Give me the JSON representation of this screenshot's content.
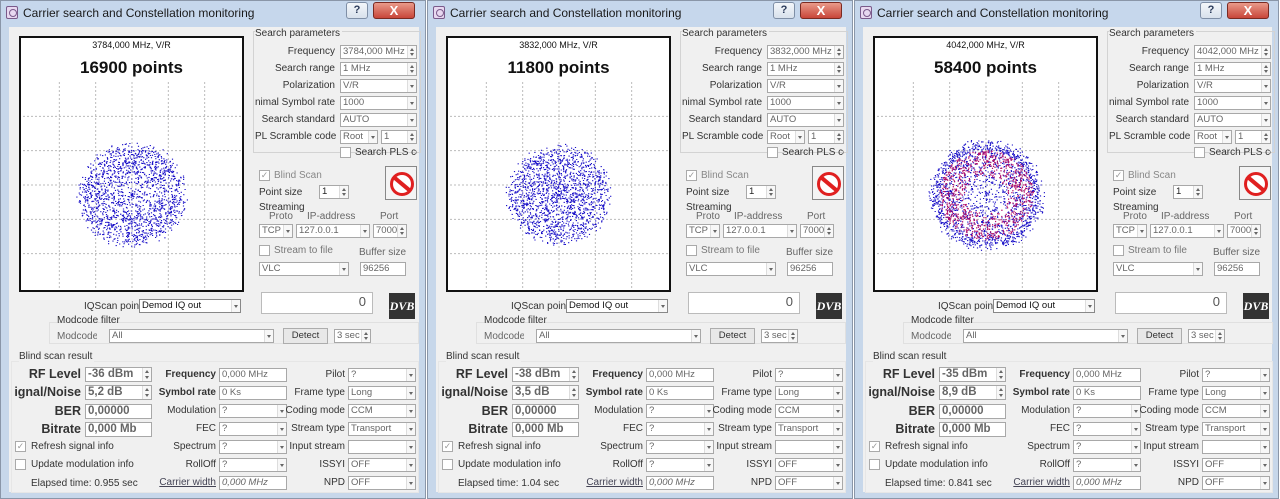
{
  "panels": [
    {
      "title": "Carrier search and Constellation monitoring",
      "help": "?",
      "close": "X",
      "plot": {
        "freq_label": "3784,000 MHz, V/R",
        "points": "16900 points",
        "inner": 0.12,
        "outer": 0.84,
        "dense": false
      },
      "search": {
        "header": "Search parameters",
        "frequency_label": "Frequency",
        "frequency": "3784,000 MHz",
        "range_label": "Search range",
        "range": "1 MHz",
        "pol_label": "Polarization",
        "pol": "V/R",
        "symrate_label": "nimal Symbol rate",
        "symrate": "1000",
        "standard_label": "Search standard",
        "standard": "AUTO",
        "pls_label": "PL Scramble code",
        "pls_mode": "Root",
        "pls_value": "1",
        "search_pls": "Search PLS cc"
      },
      "blind": {
        "label": "Blind Scan",
        "point_size_label": "Point size",
        "point_size": "1"
      },
      "streaming": {
        "header": "Streaming",
        "proto_label": "Proto",
        "ip_label": "IP-address",
        "port_label": "Port",
        "proto": "TCP",
        "ip": "127.0.0.1",
        "port": "7000",
        "to_file": "Stream to file",
        "buffer_label": "Buffer size",
        "player": "VLC",
        "buffer": "96256"
      },
      "indicator": "0",
      "dvb": "DVB",
      "iq": {
        "label": "IQScan point",
        "value": "Demod IQ out"
      },
      "modcode": {
        "header": "Modcode filter",
        "label": "Modcode",
        "value": "All",
        "detect": "Detect",
        "sec": "3 sec"
      },
      "result": {
        "header": "Blind scan result",
        "rf_label": "RF Level",
        "rf": "-36 dBm",
        "sn_label": "ignal/Noise",
        "sn": "5,2 dB",
        "ber_label": "BER",
        "ber": "0,00000",
        "bitrate_label": "Bitrate",
        "bitrate": "0,000 Mb",
        "freq_label": "Frequency",
        "freq": "0,000 MHz",
        "sym_label": "Symbol rate",
        "sym": "0 Ks",
        "modulation_label": "Modulation",
        "modulation": "?",
        "fec_label": "FEC",
        "fec": "?",
        "spectrum_label": "Spectrum",
        "spectrum": "?",
        "rolloff_label": "RollOff",
        "rolloff": "?",
        "cw_label": "Carrier width",
        "cw": "0,000 MHz",
        "pilot_label": "Pilot",
        "pilot": "?",
        "frame_label": "Frame type",
        "frame": "Long",
        "coding_label": "Coding mode",
        "coding": "CCM",
        "stype_label": "Stream type",
        "stype": "Transport",
        "istream_label": "Input stream",
        "istream": "",
        "issyi_label": "ISSYI",
        "issyi": "OFF",
        "npd_label": "NPD",
        "npd": "OFF",
        "refresh": "Refresh signal info",
        "update": "Update modulation info",
        "elapsed": "Elapsed time: 0.955 sec"
      }
    },
    {
      "title": "Carrier search and Constellation monitoring",
      "help": "?",
      "close": "X",
      "plot": {
        "freq_label": "3832,000 MHz, V/R",
        "points": "11800 points",
        "inner": 0.0,
        "outer": 0.8,
        "dense": false
      },
      "search": {
        "header": "Search parameters",
        "frequency_label": "Frequency",
        "frequency": "3832,000 MHz",
        "range_label": "Search range",
        "range": "1 MHz",
        "pol_label": "Polarization",
        "pol": "V/R",
        "symrate_label": "nimal Symbol rate",
        "symrate": "1000",
        "standard_label": "Search standard",
        "standard": "AUTO",
        "pls_label": "PL Scramble code",
        "pls_mode": "Root",
        "pls_value": "1",
        "search_pls": "Search PLS cc"
      },
      "blind": {
        "label": "Blind Scan",
        "point_size_label": "Point size",
        "point_size": "1"
      },
      "streaming": {
        "header": "Streaming",
        "proto_label": "Proto",
        "ip_label": "IP-address",
        "port_label": "Port",
        "proto": "TCP",
        "ip": "127.0.0.1",
        "port": "7000",
        "to_file": "Stream to file",
        "buffer_label": "Buffer size",
        "player": "VLC",
        "buffer": "96256"
      },
      "indicator": "0",
      "dvb": "DVB",
      "iq": {
        "label": "IQScan point",
        "value": "Demod IQ out"
      },
      "modcode": {
        "header": "Modcode filter",
        "label": "Modcode",
        "value": "All",
        "detect": "Detect",
        "sec": "3 sec"
      },
      "result": {
        "header": "Blind scan result",
        "rf_label": "RF Level",
        "rf": "-38 dBm",
        "sn_label": "ignal/Noise",
        "sn": "3,5 dB",
        "ber_label": "BER",
        "ber": "0,00000",
        "bitrate_label": "Bitrate",
        "bitrate": "0,000 Mb",
        "freq_label": "Frequency",
        "freq": "0,000 MHz",
        "sym_label": "Symbol rate",
        "sym": "0 Ks",
        "modulation_label": "Modulation",
        "modulation": "?",
        "fec_label": "FEC",
        "fec": "?",
        "spectrum_label": "Spectrum",
        "spectrum": "?",
        "rolloff_label": "RollOff",
        "rolloff": "?",
        "cw_label": "Carrier width",
        "cw": "0,000 MHz",
        "pilot_label": "Pilot",
        "pilot": "?",
        "frame_label": "Frame type",
        "frame": "Long",
        "coding_label": "Coding mode",
        "coding": "CCM",
        "stype_label": "Stream type",
        "stype": "Transport",
        "istream_label": "Input stream",
        "istream": "",
        "issyi_label": "ISSYI",
        "issyi": "OFF",
        "npd_label": "NPD",
        "npd": "OFF",
        "refresh": "Refresh signal info",
        "update": "Update modulation info",
        "elapsed": "Elapsed time: 1.04 sec"
      }
    },
    {
      "title": "Carrier search and Constellation monitoring",
      "help": "?",
      "close": "X",
      "plot": {
        "freq_label": "4042,000 MHz, V/R",
        "points": "58400 points",
        "inner": 0.22,
        "outer": 0.88,
        "dense": true
      },
      "search": {
        "header": "Search parameters",
        "frequency_label": "Frequency",
        "frequency": "4042,000 MHz",
        "range_label": "Search range",
        "range": "1 MHz",
        "pol_label": "Polarization",
        "pol": "V/R",
        "symrate_label": "nimal Symbol rate",
        "symrate": "1000",
        "standard_label": "Search standard",
        "standard": "AUTO",
        "pls_label": "PL Scramble code",
        "pls_mode": "Root",
        "pls_value": "1",
        "search_pls": "Search PLS cc"
      },
      "blind": {
        "label": "Blind Scan",
        "point_size_label": "Point size",
        "point_size": "1"
      },
      "streaming": {
        "header": "Streaming",
        "proto_label": "Proto",
        "ip_label": "IP-address",
        "port_label": "Port",
        "proto": "TCP",
        "ip": "127.0.0.1",
        "port": "7000",
        "to_file": "Stream to file",
        "buffer_label": "Buffer size",
        "player": "VLC",
        "buffer": "96256"
      },
      "indicator": "0",
      "dvb": "DVB",
      "iq": {
        "label": "IQScan point",
        "value": "Demod IQ out"
      },
      "modcode": {
        "header": "Modcode filter",
        "label": "Modcode",
        "value": "All",
        "detect": "Detect",
        "sec": "3 sec"
      },
      "result": {
        "header": "Blind scan result",
        "rf_label": "RF Level",
        "rf": "-35 dBm",
        "sn_label": "ignal/Noise",
        "sn": "8,9 dB",
        "ber_label": "BER",
        "ber": "0,00000",
        "bitrate_label": "Bitrate",
        "bitrate": "0,000 Mb",
        "freq_label": "Frequency",
        "freq": "0,000 MHz",
        "sym_label": "Symbol rate",
        "sym": "0 Ks",
        "modulation_label": "Modulation",
        "modulation": "?",
        "fec_label": "FEC",
        "fec": "?",
        "spectrum_label": "Spectrum",
        "spectrum": "?",
        "rolloff_label": "RollOff",
        "rolloff": "?",
        "cw_label": "Carrier width",
        "cw": "0,000 MHz",
        "pilot_label": "Pilot",
        "pilot": "?",
        "frame_label": "Frame type",
        "frame": "Long",
        "coding_label": "Coding mode",
        "coding": "CCM",
        "stype_label": "Stream type",
        "stype": "Transport",
        "istream_label": "Input stream",
        "istream": "",
        "issyi_label": "ISSYI",
        "issyi": "OFF",
        "npd_label": "NPD",
        "npd": "OFF",
        "refresh": "Refresh signal info",
        "update": "Update modulation info",
        "elapsed": "Elapsed time: 0.841 sec"
      }
    }
  ],
  "colors": {
    "point": "#1a10c8",
    "dense_point": "#b0106a",
    "title_bar": "#c6d7ec",
    "close": "#c8463a"
  }
}
